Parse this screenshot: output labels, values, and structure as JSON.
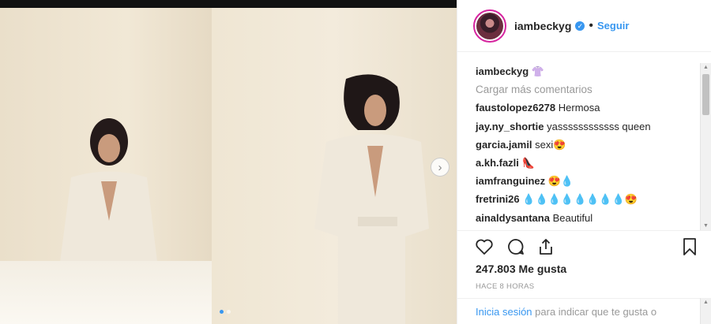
{
  "post": {
    "username": "iambeckyg",
    "separator": "•",
    "follow_label": "Seguir",
    "verified_mark": "✓"
  },
  "caption": {
    "username": "iambeckyg",
    "text": "👚"
  },
  "load_more_label": "Cargar más comentarios",
  "comments": [
    {
      "user": "faustolopez6278",
      "text": "Hermosa"
    },
    {
      "user": "jay.ny_shortie",
      "text": "yassssssssssss queen"
    },
    {
      "user": "garcia.jamil",
      "text": "sexi😍"
    },
    {
      "user": "a.kh.fazli",
      "text": "👠"
    },
    {
      "user": "iamfranguinez",
      "text": "😍💧"
    },
    {
      "user": "fretrini26",
      "text": "💧💧💧💧💧💧💧💧😍"
    },
    {
      "user": "ainaldysantana",
      "text": "Beautiful"
    }
  ],
  "likes_label": "247.803 Me gusta",
  "time_label": "HACE 8 HORAS",
  "footer": {
    "login": "Inicia sesión",
    "rest": " para indicar que te gusta o"
  },
  "carousel": {
    "next_glyph": "›",
    "total": 2,
    "current": 1
  },
  "colors": {
    "accent": "#3897f0",
    "text": "#262626",
    "muted": "#999999"
  }
}
